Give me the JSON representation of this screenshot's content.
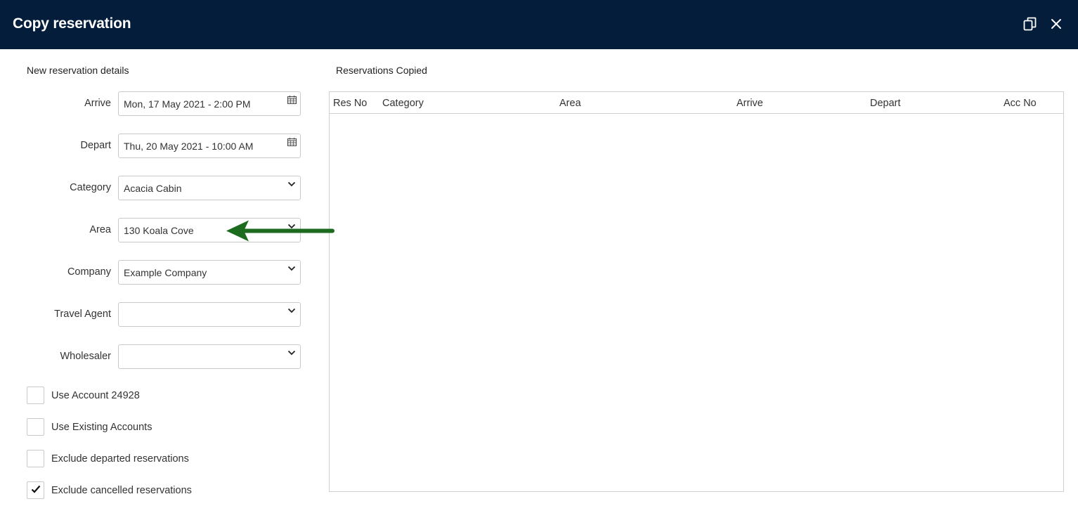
{
  "window": {
    "title": "Copy reservation",
    "icons": [
      "copy-icon",
      "close-icon"
    ]
  },
  "form": {
    "section_title": "New reservation details",
    "fields": [
      {
        "label": "Arrive",
        "value": "Mon, 17 May 2021 - 2:00 PM",
        "icon": "calendar-icon"
      },
      {
        "label": "Depart",
        "value": "Thu, 20 May 2021 - 10:00 AM",
        "icon": "calendar-icon"
      },
      {
        "label": "Category",
        "value": "Acacia Cabin",
        "icon": "chevron-down-icon"
      },
      {
        "label": "Area",
        "value": "130 Koala Cove",
        "icon": "chevron-down-icon"
      },
      {
        "label": "Company",
        "value": "Example Company",
        "icon": "chevron-down-icon"
      },
      {
        "label": "Travel Agent",
        "value": "",
        "icon": "chevron-down-icon"
      },
      {
        "label": "Wholesaler",
        "value": "",
        "icon": "chevron-down-icon"
      }
    ],
    "checkboxes": [
      {
        "label": "Use Account 24928",
        "checked": false
      },
      {
        "label": "Use Existing Accounts",
        "checked": false
      },
      {
        "label": "Exclude departed reservations",
        "checked": false
      },
      {
        "label": "Exclude cancelled reservations",
        "checked": true
      }
    ]
  },
  "copied": {
    "section_title": "Reservations Copied",
    "columns": [
      "Res No",
      "Category",
      "Area",
      "Arrive",
      "Depart",
      "Acc No"
    ],
    "rows": []
  },
  "annotation": {
    "arrow_color": "#1c6b1f"
  }
}
